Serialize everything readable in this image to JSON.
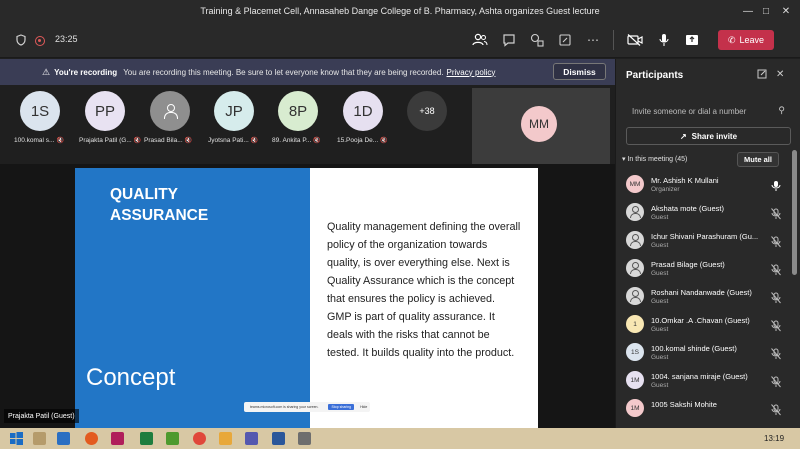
{
  "window": {
    "title": "Training & Placemet Cell, Annasaheb Dange College of B. Pharmacy, Ashta organizes Guest lecture"
  },
  "toolbar": {
    "timer": "23:25",
    "leave_label": "Leave"
  },
  "banner": {
    "heading": "You're recording",
    "message": "You are recording this meeting. Be sure to let everyone know that they are being recorded.",
    "link": "Privacy policy",
    "dismiss_label": "Dismiss"
  },
  "strip": [
    {
      "initials": "1S",
      "label": "100.komal s...",
      "color": "#dbe4ee"
    },
    {
      "initials": "PP",
      "label": "Prajakta Patil (G...",
      "color": "#e8e2f2"
    },
    {
      "initials": "",
      "label": "Prasad Bila...",
      "color": "#8f8f8f"
    },
    {
      "initials": "JP",
      "label": "Jyotsna Pati...",
      "color": "#d6ecec"
    },
    {
      "initials": "8P",
      "label": "89. Ankita P...",
      "color": "#d8ecd0"
    },
    {
      "initials": "1D",
      "label": "15.Pooja De...",
      "color": "#e6e0f0"
    }
  ],
  "more_count": "+38",
  "video_tile": {
    "initials": "MM",
    "color": "#f3c9cb"
  },
  "slide": {
    "title_line1": "QUALITY",
    "title_line2": "ASSURANCE",
    "concept": "Concept",
    "body": "Quality management defining the overall policy of the organization towards quality, is over everything else. Next is Quality Assurance which is the concept that ensures the policy is achieved. GMP is part of quality assurance. It deals with the risks that cannot be tested. It builds quality into the product."
  },
  "stage_name_label": "Prajakta Patil (Guest)",
  "share_bar": {
    "text": "teams.microsoft.com is sharing your screen.",
    "stop_label": "Stop sharing",
    "hide_label": "Hide"
  },
  "panel": {
    "title": "Participants",
    "invite_placeholder": "Invite someone or dial a number",
    "share_invite_label": "Share invite",
    "in_meeting_label": "In this meeting (45)",
    "mute_all_label": "Mute all",
    "participants": [
      {
        "name": "Mr. Ashish K Mullani",
        "role": "Organizer",
        "avatar": "MM",
        "color": "#f3c9cb"
      },
      {
        "name": "Akshata mote (Guest)",
        "role": "Guest",
        "avatar": "",
        "color": "#d8d8d8"
      },
      {
        "name": "Ichur Shivani Parashuram (Gu...",
        "role": "Guest",
        "avatar": "",
        "color": "#d8d8d8"
      },
      {
        "name": "Prasad Bilage (Guest)",
        "role": "Guest",
        "avatar": "",
        "color": "#d8d8d8"
      },
      {
        "name": "Roshani Nandanwade (Guest)",
        "role": "Guest",
        "avatar": "",
        "color": "#d8d8d8"
      },
      {
        "name": "10.Omkar .A .Chavan (Guest)",
        "role": "Guest",
        "avatar": "1",
        "color": "#f8e7b3"
      },
      {
        "name": "100.komal shinde (Guest)",
        "role": "Guest",
        "avatar": "1S",
        "color": "#dbe4ee"
      },
      {
        "name": "1004. sanjana miraje (Guest)",
        "role": "Guest",
        "avatar": "1M",
        "color": "#e6e0f0"
      },
      {
        "name": "1005 Sakshi Mohite",
        "role": "",
        "avatar": "1M",
        "color": "#f3c9cb"
      }
    ]
  },
  "taskbar": {
    "clock": "13:19"
  }
}
